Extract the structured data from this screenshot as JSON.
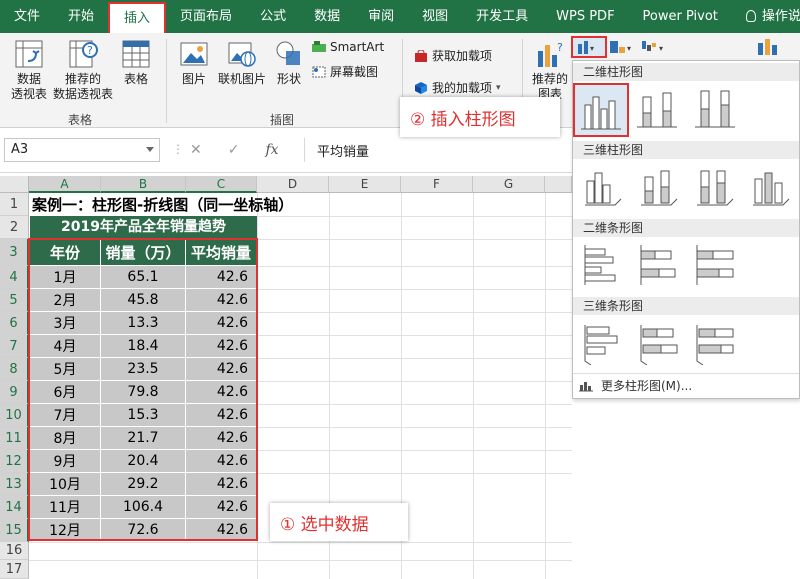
{
  "ribbon_tabs": [
    "文件",
    "开始",
    "插入",
    "页面布局",
    "公式",
    "数据",
    "审阅",
    "视图",
    "开发工具",
    "WPS PDF",
    "Power Pivot",
    "操作说明搜索"
  ],
  "active_tab": "插入",
  "ribbon": {
    "pivot_table": "数据\n透视表",
    "pivot_line1": "数据",
    "pivot_line2": "透视表",
    "rec_pivot_line1": "推荐的",
    "rec_pivot_line2": "数据透视表",
    "table": "表格",
    "group_tables": "表格",
    "picture": "图片",
    "online_picture": "联机图片",
    "shapes": "形状",
    "smartart": "SmartArt",
    "screenshot": "屏幕截图",
    "group_illustrations": "插图",
    "get_addins": "获取加载项",
    "my_addins": "我的加载项",
    "rec_charts_line1": "推荐的",
    "rec_charts_line2": "图表"
  },
  "formula_bar": {
    "name_box": "A3",
    "fx": "fx",
    "content": "平均销量"
  },
  "columns": [
    "A",
    "B",
    "C",
    "D",
    "E",
    "F",
    "G"
  ],
  "rows": [
    "1",
    "2",
    "3",
    "4",
    "5",
    "6",
    "7",
    "8",
    "9",
    "10",
    "11",
    "12",
    "13",
    "14",
    "15",
    "16",
    "17"
  ],
  "sheet": {
    "title": "案例一：柱形图-折线图（同一坐标轴）",
    "banner": "2019年产品全年销量趋势",
    "headers": [
      "年份",
      "销量（万）",
      "平均销量"
    ],
    "data": [
      [
        "1月",
        "65.1",
        "42.6"
      ],
      [
        "2月",
        "45.8",
        "42.6"
      ],
      [
        "3月",
        "13.3",
        "42.6"
      ],
      [
        "4月",
        "18.4",
        "42.6"
      ],
      [
        "5月",
        "23.5",
        "42.6"
      ],
      [
        "6月",
        "79.8",
        "42.6"
      ],
      [
        "7月",
        "15.3",
        "42.6"
      ],
      [
        "8月",
        "21.7",
        "42.6"
      ],
      [
        "9月",
        "20.4",
        "42.6"
      ],
      [
        "10月",
        "29.2",
        "42.6"
      ],
      [
        "11月",
        "106.4",
        "42.6"
      ],
      [
        "12月",
        "72.6",
        "42.6"
      ]
    ]
  },
  "callouts": {
    "step1": "① 选中数据",
    "step2": "②  插入柱形图"
  },
  "chart_menu": {
    "sections": [
      "二维柱形图",
      "三维柱形图",
      "二维条形图",
      "三维条形图"
    ],
    "more": "更多柱形图(M)..."
  },
  "colors": {
    "ribbon_green": "#217346",
    "header_green": "#2e6b4a",
    "highlight_red": "#e03030",
    "data_gray": "#c8c8c8"
  }
}
